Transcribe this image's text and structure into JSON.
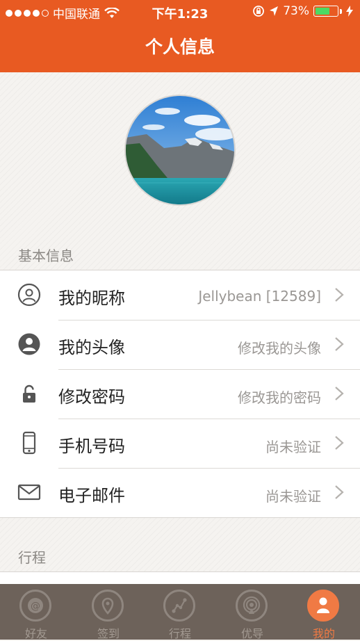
{
  "status_bar": {
    "carrier": "中国联通",
    "time": "下午1:23",
    "battery_percent": "73%",
    "battery_level": 0.73,
    "icons": [
      "signal-dots-icon",
      "wifi-icon",
      "rotation-lock-icon",
      "location-arrow-icon",
      "battery-icon",
      "charging-bolt-icon"
    ]
  },
  "header": {
    "title": "个人信息"
  },
  "sections": {
    "basic": {
      "title": "基本信息",
      "rows": [
        {
          "icon": "user-circle-icon",
          "label": "我的昵称",
          "value": "Jellybean [12589]"
        },
        {
          "icon": "user-avatar-icon",
          "label": "我的头像",
          "value": "修改我的头像"
        },
        {
          "icon": "lock-icon",
          "label": "修改密码",
          "value": "修改我的密码"
        },
        {
          "icon": "phone-icon",
          "label": "手机号码",
          "value": "尚未验证"
        },
        {
          "icon": "mail-icon",
          "label": "电子邮件",
          "value": "尚未验证"
        }
      ]
    },
    "trip": {
      "title": "行程"
    }
  },
  "tabbar": {
    "tabs": [
      {
        "icon": "at-icon",
        "label": "好友"
      },
      {
        "icon": "location-pin-icon",
        "label": "签到"
      },
      {
        "icon": "route-icon",
        "label": "行程"
      },
      {
        "icon": "broadcast-icon",
        "label": "优导"
      },
      {
        "icon": "person-icon",
        "label": "我的"
      }
    ],
    "active_index": 4
  },
  "colors": {
    "accent": "#e85a22",
    "tab_active": "#f07a44",
    "tabbar_bg": "#6d625a",
    "battery_fill": "#4cd964"
  }
}
